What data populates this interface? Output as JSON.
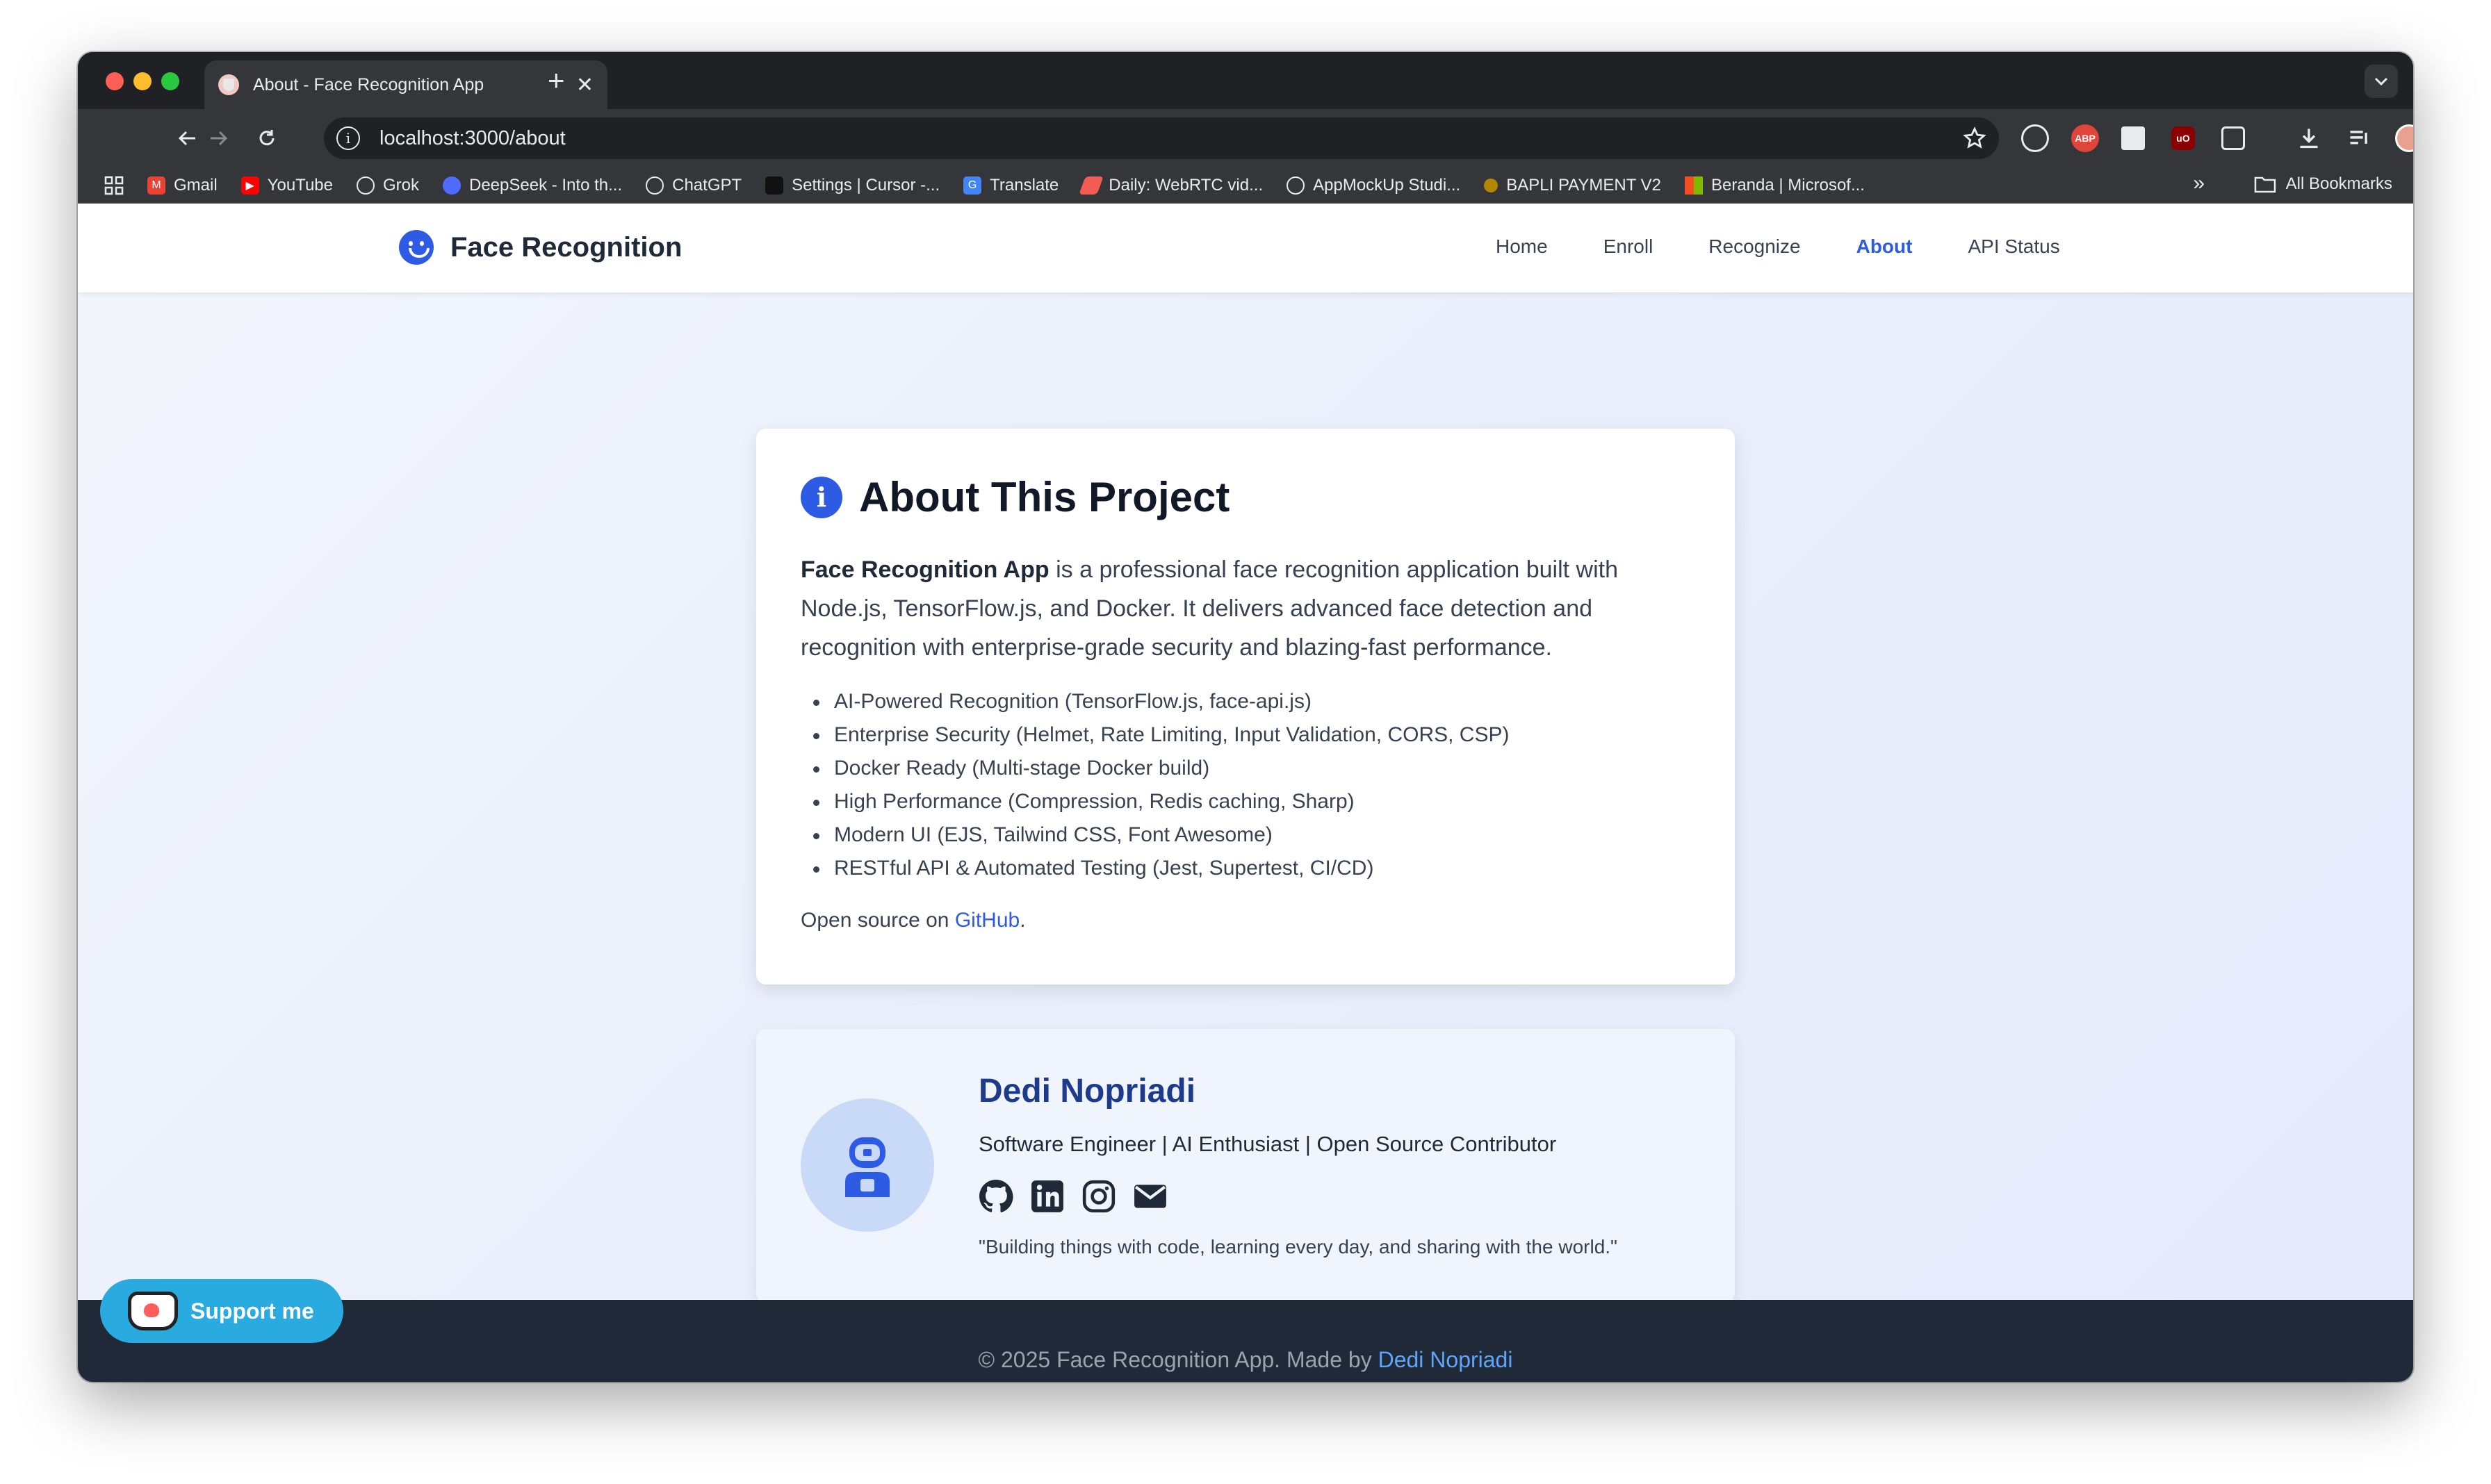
{
  "browser": {
    "tab_title": "About - Face Recognition App",
    "tab_close": "✕",
    "new_tab": "+",
    "url": "localhost:3000/about",
    "bookmarks": [
      {
        "label": "Gmail",
        "icon": "gmail-icon",
        "color": "#ea4335"
      },
      {
        "label": "YouTube",
        "icon": "youtube-icon",
        "color": "#ff0000"
      },
      {
        "label": "Grok",
        "icon": "grok-icon",
        "color": "#35363a"
      },
      {
        "label": "DeepSeek - Into th...",
        "icon": "deepseek-icon",
        "color": "#4d6bfe"
      },
      {
        "label": "ChatGPT",
        "icon": "chatgpt-icon",
        "color": "#35363a"
      },
      {
        "label": "Settings | Cursor -...",
        "icon": "cursor-icon",
        "color": "#111111"
      },
      {
        "label": "Translate",
        "icon": "translate-icon",
        "color": "#4285f4"
      },
      {
        "label": "Daily: WebRTC vid...",
        "icon": "daily-icon",
        "color": "#f25c54"
      },
      {
        "label": "AppMockUp Studi...",
        "icon": "appmockup-icon",
        "color": "#35363a"
      },
      {
        "label": "BAPLI PAYMENT V2",
        "icon": "bapli-icon",
        "color": "#f4b400"
      },
      {
        "label": "Beranda | Microsof...",
        "icon": "microsoft-icon",
        "color": "#f25022"
      }
    ],
    "all_bookmarks": "All Bookmarks"
  },
  "app": {
    "brand": "Face Recognition",
    "nav": [
      {
        "label": "Home",
        "active": false
      },
      {
        "label": "Enroll",
        "active": false
      },
      {
        "label": "Recognize",
        "active": false
      },
      {
        "label": "About",
        "active": true
      },
      {
        "label": "API Status",
        "active": false
      }
    ]
  },
  "about": {
    "title": "About This Project",
    "intro_bold": "Face Recognition App",
    "intro_rest": " is a professional face recognition application built with Node.js, TensorFlow.js, and Docker. It delivers advanced face detection and recognition with enterprise-grade security and blazing-fast performance.",
    "features": [
      "AI-Powered Recognition (TensorFlow.js, face-api.js)",
      "Enterprise Security (Helmet, Rate Limiting, Input Validation, CORS, CSP)",
      "Docker Ready (Multi-stage Docker build)",
      "High Performance (Compression, Redis caching, Sharp)",
      "Modern UI (EJS, Tailwind CSS, Font Awesome)",
      "RESTful API & Automated Testing (Jest, Supertest, CI/CD)"
    ],
    "open_source_prefix": "Open source on ",
    "open_source_link": "GitHub",
    "open_source_suffix": "."
  },
  "profile": {
    "name": "Dedi Nopriadi",
    "role": "Software Engineer | AI Enthusiast | Open Source Contributor",
    "quote": "\"Building things with code, learning every day, and sharing with the world.\""
  },
  "footer": {
    "prefix": "© 2025 Face Recognition App. Made by ",
    "author": "Dedi Nopriadi"
  },
  "support": {
    "label": "Support me"
  },
  "colors": {
    "accent": "#2d5be3",
    "footer": "#1f2937",
    "support": "#29abe0"
  }
}
